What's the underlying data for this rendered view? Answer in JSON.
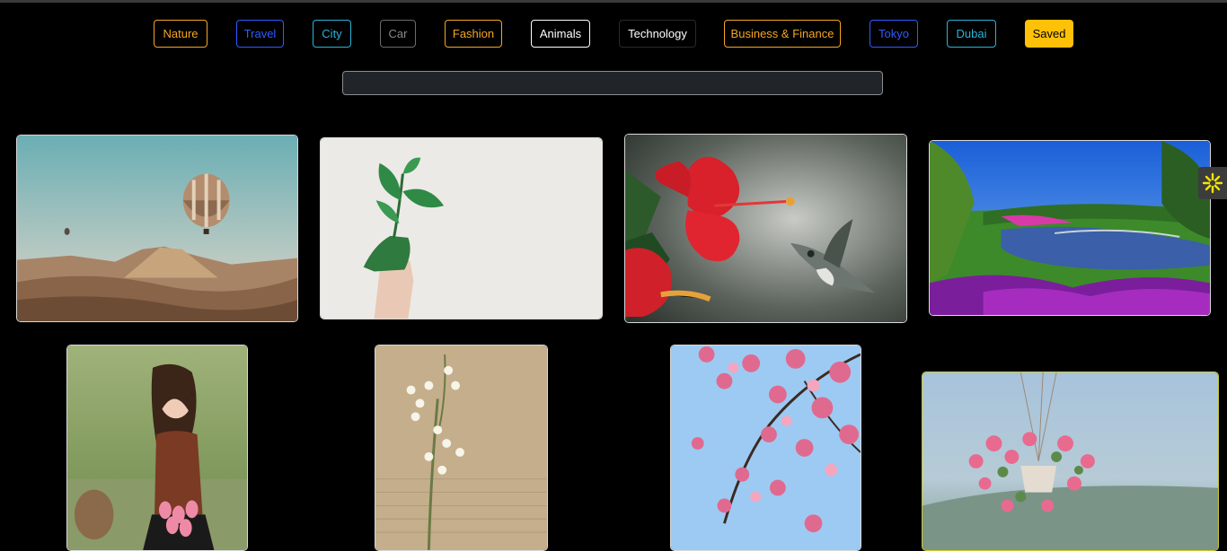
{
  "filters": [
    {
      "label": "Nature",
      "color": "#f5a623"
    },
    {
      "label": "Travel",
      "color": "#2f5bff"
    },
    {
      "label": "City",
      "color": "#2bb3d9"
    },
    {
      "label": "Car",
      "color": "#8a8a8a"
    },
    {
      "label": "Fashion",
      "color": "#f5a623"
    },
    {
      "label": "Animals",
      "color": "#ffffff"
    },
    {
      "label": "Technology",
      "color": "#ffffff"
    },
    {
      "label": "Business & Finance",
      "color": "#f5a623"
    },
    {
      "label": "Tokyo",
      "color": "#2f5bff"
    },
    {
      "label": "Dubai",
      "color": "#2bb3d9"
    }
  ],
  "saved": {
    "label": "Saved",
    "color": "#ffc107"
  },
  "search": {
    "value": "",
    "placeholder": ""
  },
  "gallery": [
    {
      "name": "hot-air-balloon-photo"
    },
    {
      "name": "plant-in-hand-photo"
    },
    {
      "name": "hummingbird-hibiscus-photo"
    },
    {
      "name": "garden-lake-photo"
    },
    {
      "name": "woman-with-tulips-photo"
    },
    {
      "name": "lily-of-the-valley-photo"
    },
    {
      "name": "cherry-blossom-photo"
    },
    {
      "name": "hanging-flower-pot-photo"
    }
  ],
  "side_widget": {
    "icon": "asterisk-icon",
    "color": "#f2e600"
  }
}
